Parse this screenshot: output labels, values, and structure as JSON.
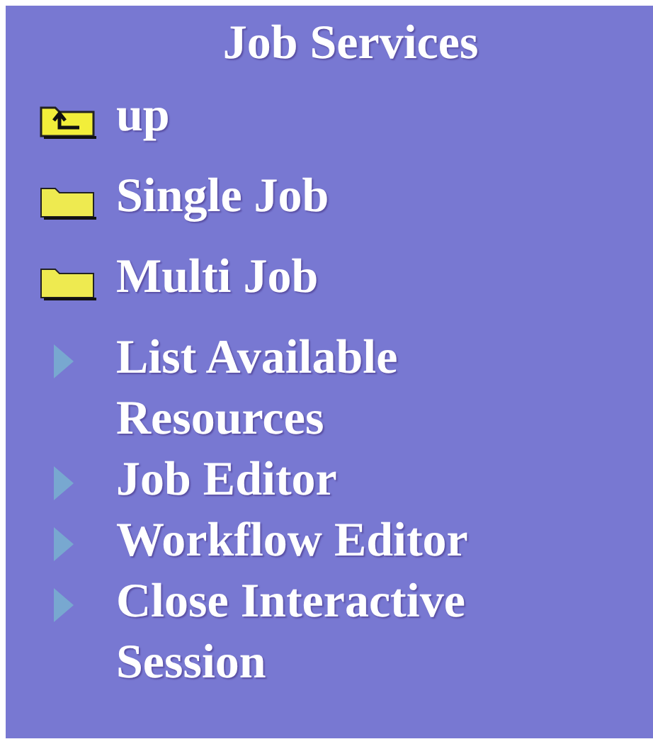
{
  "title": "Job Services",
  "items": [
    {
      "kind": "folder-up",
      "label": "up"
    },
    {
      "kind": "folder",
      "label": "Single Job"
    },
    {
      "kind": "folder",
      "label": "Multi Job"
    },
    {
      "kind": "arrow",
      "label": "List Available Resources"
    },
    {
      "kind": "arrow",
      "label": "Job Editor"
    },
    {
      "kind": "arrow",
      "label": "Workflow Editor"
    },
    {
      "kind": "arrow",
      "label": "Close Interactive Session"
    }
  ]
}
